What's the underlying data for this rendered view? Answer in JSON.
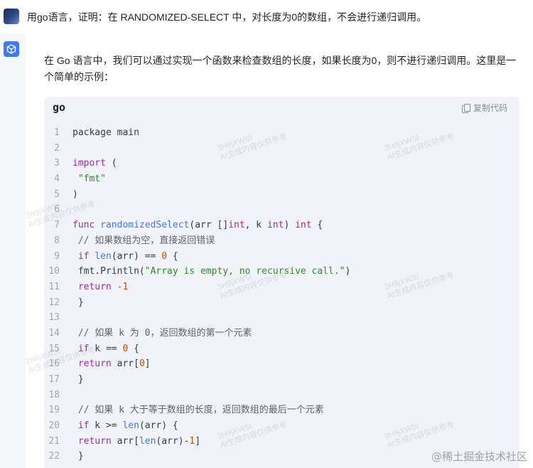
{
  "user_message": {
    "text": "用go语言，证明：在 RANDOMIZED-SELECT 中，对长度为0的数组，不会进行递归调用。"
  },
  "assistant": {
    "intro": "在 Go 语言中，我们可以通过实现一个函数来检查数组的长度，如果长度为0，则不进行递归调用。这里是一个简单的示例：",
    "code_block": {
      "language": "go",
      "copy_label": "复制代码",
      "lines": [
        {
          "n": "1",
          "html": "package main"
        },
        {
          "n": "2",
          "html": ""
        },
        {
          "n": "3",
          "html": "<span class='kw'>import</span> ("
        },
        {
          "n": "4",
          "html": " <span class='str'>\"fmt\"</span>"
        },
        {
          "n": "5",
          "html": ")"
        },
        {
          "n": "6",
          "html": ""
        },
        {
          "n": "7",
          "html": "<span class='kw'>func</span> <span class='fn'>randomizedSelect</span>(arr []<span class='tp'>int</span>, k <span class='tp'>int</span>) <span class='tp'>int</span> {"
        },
        {
          "n": "8",
          "html": " <span class='cm'>// 如果数组为空，直接返回错误</span>"
        },
        {
          "n": "9",
          "html": " <span class='kw'>if</span> <span class='fn'>len</span>(arr) == <span class='num'>0</span> {"
        },
        {
          "n": "10",
          "html": " fmt.Println(<span class='str'>\"Array is empty, no recursive call.\"</span>)"
        },
        {
          "n": "11",
          "html": " <span class='kw'>return</span> <span class='num'>-1</span>"
        },
        {
          "n": "12",
          "html": " }"
        },
        {
          "n": "13",
          "html": ""
        },
        {
          "n": "14",
          "html": " <span class='cm'>// 如果 k 为 0，返回数组的第一个元素</span>"
        },
        {
          "n": "15",
          "html": " <span class='kw'>if</span> k == <span class='num'>0</span> {"
        },
        {
          "n": "16",
          "html": " <span class='kw'>return</span> arr[<span class='num'>0</span>]"
        },
        {
          "n": "17",
          "html": " }"
        },
        {
          "n": "18",
          "html": ""
        },
        {
          "n": "19",
          "html": " <span class='cm'>// 如果 k 大于等于数组的长度，返回数组的最后一个元素</span>"
        },
        {
          "n": "20",
          "html": " <span class='kw'>if</span> k >= <span class='fn'>len</span>(arr) {"
        },
        {
          "n": "21",
          "html": " <span class='kw'>return</span> arr[<span class='fn'>len</span>(arr)-<span class='num'>1</span>]"
        },
        {
          "n": "22",
          "html": " }"
        }
      ]
    }
  },
  "watermark_text": [
    "3H9jXWSI",
    "AI生成内容仅供参考"
  ],
  "footer_mark": "@稀土掘金技术社区",
  "colors": {
    "accent": "#3e7bfa",
    "page_bg": "#f6f7f9",
    "code_bg": "#f1f3f8"
  }
}
